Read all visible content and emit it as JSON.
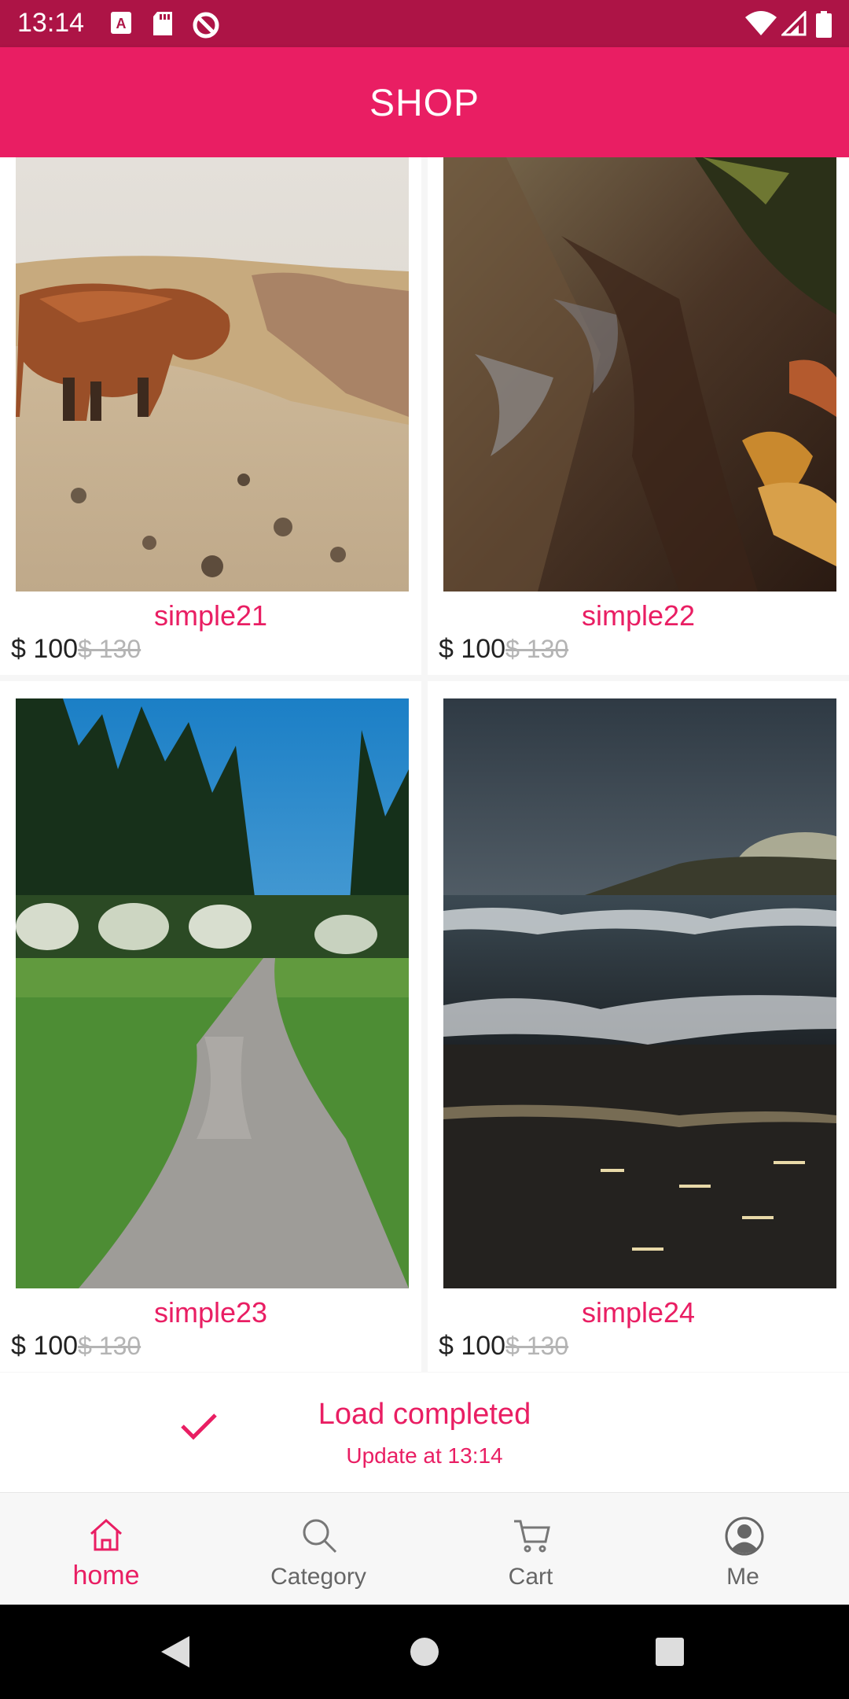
{
  "status_bar": {
    "time": "13:14",
    "left_icons": [
      "keyboard-a-icon",
      "sd-card-icon",
      "do-not-disturb-icon"
    ],
    "right_icons": [
      "wifi-icon",
      "signal-icon",
      "battery-icon"
    ],
    "color": "#ad1446"
  },
  "app_bar": {
    "title": "SHOP",
    "color": "#e91e63"
  },
  "products": [
    {
      "name": "simple21",
      "price": "$ 100",
      "old_price": "$ 130",
      "image": "highland-cow-photo"
    },
    {
      "name": "simple22",
      "price": "$ 100",
      "old_price": "$ 130",
      "image": "tree-bark-photo"
    },
    {
      "name": "simple23",
      "price": "$ 100",
      "old_price": "$ 130",
      "image": "forest-path-photo"
    },
    {
      "name": "simple24",
      "price": "$ 100",
      "old_price": "$ 130",
      "image": "ocean-shore-photo"
    }
  ],
  "load_status": {
    "title": "Load completed",
    "subtitle": "Update at 13:14",
    "icon": "check-icon"
  },
  "bottom_nav": {
    "active": "home",
    "items": [
      {
        "label": "home",
        "icon": "home-icon"
      },
      {
        "label": "Category",
        "icon": "search-icon"
      },
      {
        "label": "Cart",
        "icon": "cart-icon"
      },
      {
        "label": "Me",
        "icon": "profile-icon"
      }
    ],
    "active_color": "#e91e63"
  }
}
